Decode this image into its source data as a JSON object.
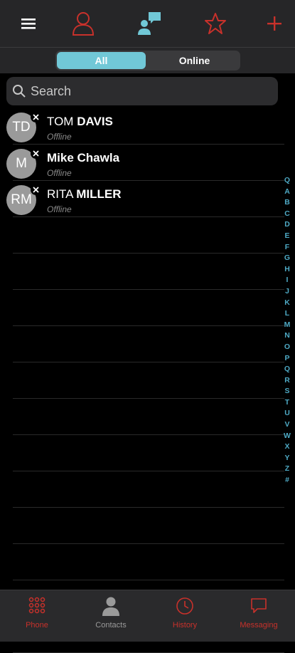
{
  "toolbar": {
    "icons": [
      "menu-icon",
      "person-icon",
      "chat-icon",
      "star-icon",
      "plus-icon"
    ],
    "accent_color": "#c8312b",
    "active_color": "#71c8d7"
  },
  "segment": {
    "all_label": "All",
    "online_label": "Online"
  },
  "search": {
    "placeholder": "Search"
  },
  "contacts": [
    {
      "initials": "TD",
      "first": "TOM ",
      "last": "DAVIS",
      "status": "Offline"
    },
    {
      "initials": "M",
      "first": "",
      "last": "Mike Chawla",
      "status": "Offline"
    },
    {
      "initials": "RM",
      "first": "RITA ",
      "last": "MILLER",
      "status": "Offline"
    }
  ],
  "alphabet": [
    "Q",
    "A",
    "B",
    "C",
    "D",
    "E",
    "F",
    "G",
    "H",
    "I",
    "J",
    "K",
    "L",
    "M",
    "N",
    "O",
    "P",
    "Q",
    "R",
    "S",
    "T",
    "U",
    "V",
    "W",
    "X",
    "Y",
    "Z",
    "#"
  ],
  "tabs": {
    "phone": "Phone",
    "contacts": "Contacts",
    "history": "History",
    "messaging": "Messaging"
  }
}
